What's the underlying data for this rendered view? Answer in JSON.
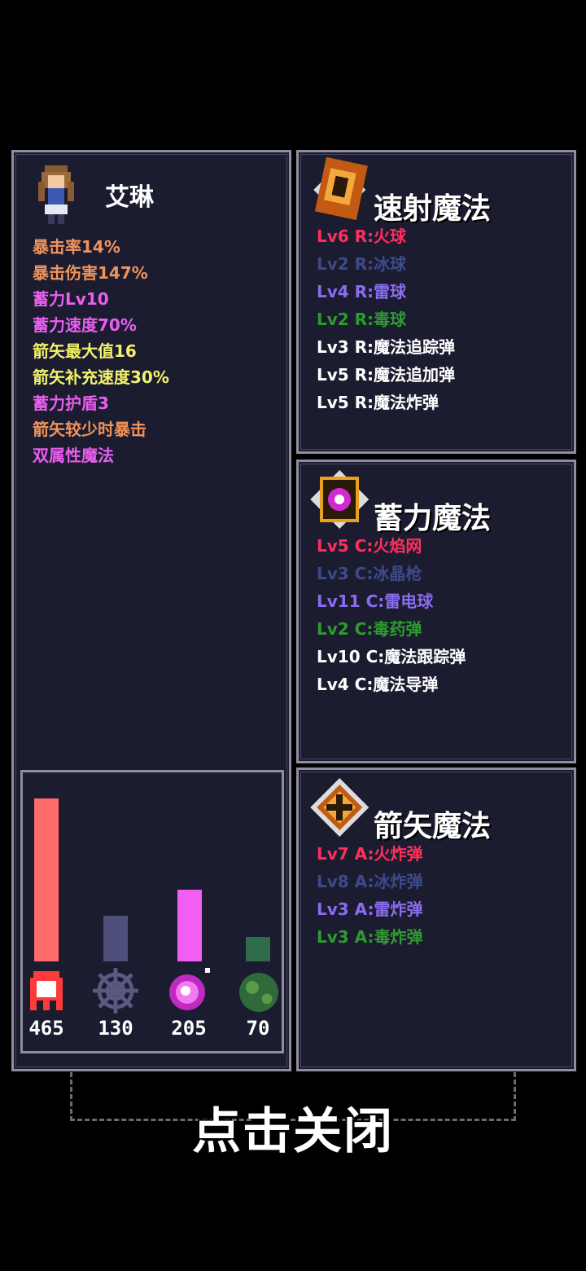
{
  "character": {
    "name": "艾琳",
    "stats": [
      {
        "text": "暴击率14%",
        "color": "#f0945a"
      },
      {
        "text": "暴击伤害147%",
        "color": "#f0945a"
      },
      {
        "text": "蓄力Lv10",
        "color": "#ea5ef0"
      },
      {
        "text": "蓄力速度70%",
        "color": "#ea5ef0"
      },
      {
        "text": "箭矢最大值16",
        "color": "#f2f26a"
      },
      {
        "text": "箭矢补充速度30%",
        "color": "#f2f26a"
      },
      {
        "text": "蓄力护盾3",
        "color": "#ea5ef0"
      },
      {
        "text": "箭矢较少时暴击",
        "color": "#f0945a"
      },
      {
        "text": "双属性魔法",
        "color": "#ea5ef0"
      }
    ]
  },
  "resources": [
    {
      "icon": "fire-ghost-icon",
      "value": "465",
      "level": 1.0,
      "color": "#ff6a6a"
    },
    {
      "icon": "ice-web-icon",
      "value": "130",
      "level": 0.28,
      "color": "#4f4f7c"
    },
    {
      "icon": "thunder-orb-icon",
      "value": "205",
      "level": 0.44,
      "color": "#f15ef1"
    },
    {
      "icon": "poison-blob-icon",
      "value": "70",
      "level": 0.15,
      "color": "#2f6a4a"
    }
  ],
  "magic_panels": [
    {
      "title": "速射魔法",
      "icon": "rapid-magic-icon",
      "skills": [
        {
          "text": "Lv6 R:火球",
          "color": "#ff2f5c"
        },
        {
          "text": "Lv2 R:冰球",
          "color": "#3d4a8a"
        },
        {
          "text": "Lv4 R:雷球",
          "color": "#8a6cf0"
        },
        {
          "text": "Lv2 R:毒球",
          "color": "#2e9b2e"
        },
        {
          "text": "Lv3 R:魔法追踪弹",
          "color": "#ffffff"
        },
        {
          "text": "Lv5 R:魔法追加弹",
          "color": "#ffffff"
        },
        {
          "text": "Lv5 R:魔法炸弹",
          "color": "#ffffff"
        }
      ]
    },
    {
      "title": "蓄力魔法",
      "icon": "charge-magic-icon",
      "skills": [
        {
          "text": "Lv5 C:火焰网",
          "color": "#ff2f5c"
        },
        {
          "text": "Lv3 C:冰晶枪",
          "color": "#3d4a8a"
        },
        {
          "text": "Lv11 C:雷电球",
          "color": "#8a6cf0"
        },
        {
          "text": "Lv2 C:毒药弹",
          "color": "#2e9b2e"
        },
        {
          "text": "Lv10 C:魔法跟踪弹",
          "color": "#ffffff"
        },
        {
          "text": "Lv4 C:魔法导弹",
          "color": "#ffffff"
        }
      ]
    },
    {
      "title": "箭矢魔法",
      "icon": "arrow-magic-icon",
      "skills": [
        {
          "text": "Lv7 A:火炸弹",
          "color": "#ff2f5c"
        },
        {
          "text": "Lv8 A:冰炸弹",
          "color": "#3d4a8a"
        },
        {
          "text": "Lv3 A:雷炸弹",
          "color": "#8a6cf0"
        },
        {
          "text": "Lv3 A:毒炸弹",
          "color": "#2e9b2e"
        }
      ]
    }
  ],
  "close_label": "点击关闭"
}
